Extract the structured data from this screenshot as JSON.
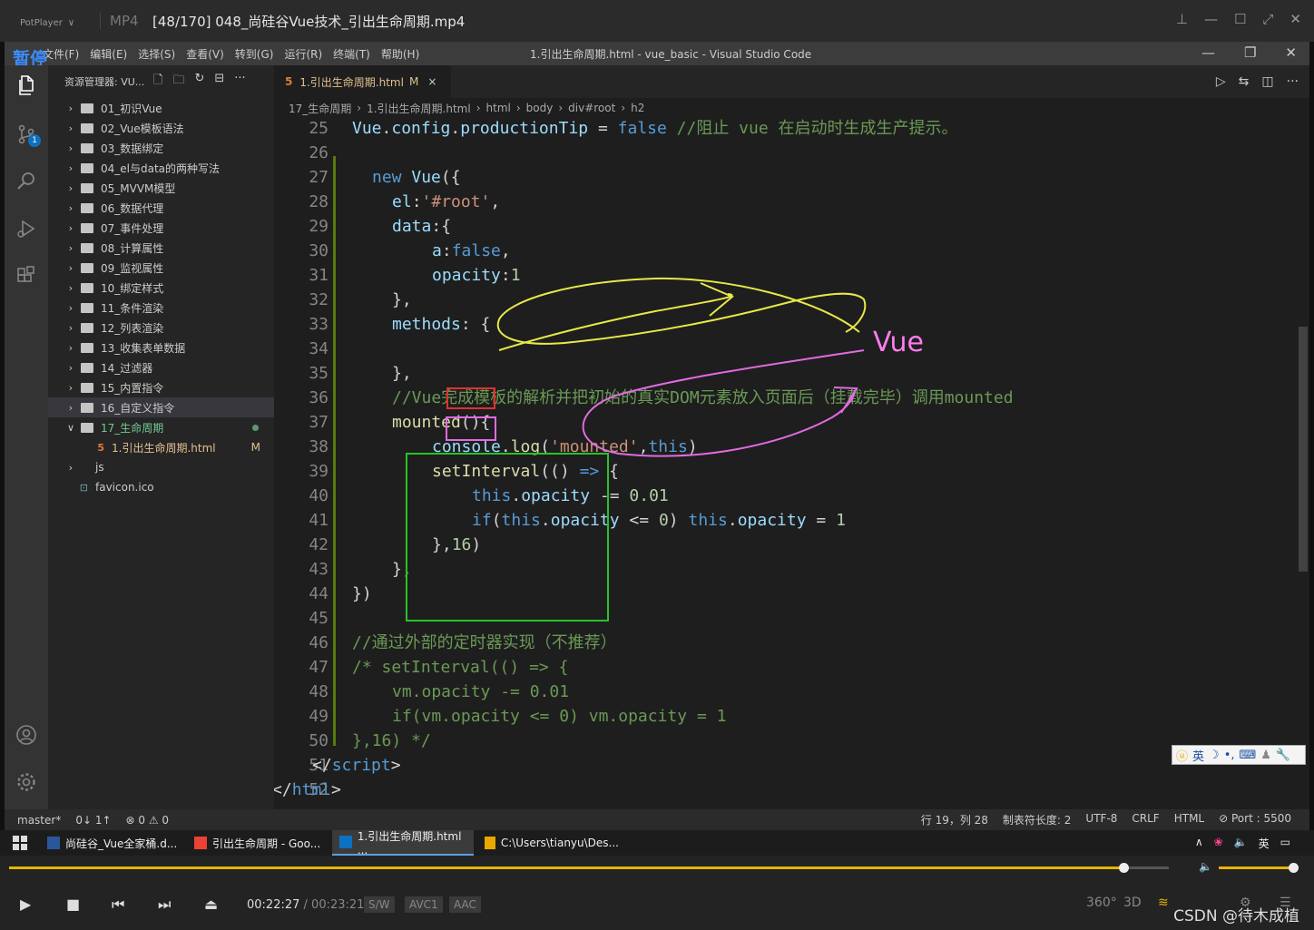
{
  "player": {
    "app_name": "PotPlayer",
    "format": "MP4",
    "file_title": "[48/170] 048_尚硅谷Vue技术_引出生命周期.mp4",
    "paused_label": "暂停",
    "time_current": "00:22:27",
    "time_total": "00:23:21",
    "chips": [
      "S/W",
      "AVC1",
      "AAC"
    ],
    "right_labels": [
      "360°",
      "3D"
    ],
    "watermark": "CSDN @待木成植",
    "progress_fraction": 0.961,
    "volume_fraction": 1.0,
    "accent_color": "#e8b400"
  },
  "vscode": {
    "menu": [
      "文件(F)",
      "编辑(E)",
      "选择(S)",
      "查看(V)",
      "转到(G)",
      "运行(R)",
      "终端(T)",
      "帮助(H)"
    ],
    "window_title": "1.引出生命周期.html - vue_basic - Visual Studio Code",
    "explorer_title": "资源管理器: VU...",
    "tree": [
      {
        "label": "01_初识Vue"
      },
      {
        "label": "02_Vue模板语法"
      },
      {
        "label": "03_数据绑定"
      },
      {
        "label": "04_el与data的两种写法"
      },
      {
        "label": "05_MVVM模型"
      },
      {
        "label": "06_数据代理"
      },
      {
        "label": "07_事件处理"
      },
      {
        "label": "08_计算属性"
      },
      {
        "label": "09_监视属性"
      },
      {
        "label": "10_绑定样式"
      },
      {
        "label": "11_条件渲染"
      },
      {
        "label": "12_列表渲染"
      },
      {
        "label": "13_收集表单数据"
      },
      {
        "label": "14_过滤器"
      },
      {
        "label": "15_内置指令"
      },
      {
        "label": "16_自定义指令"
      },
      {
        "label": "17_生命周期"
      }
    ],
    "open_file": "1.引出生命周期.html",
    "open_file_flag": "M",
    "extra_tree": [
      "js",
      "favicon.ico"
    ],
    "tab": {
      "label": "1.引出生命周期.html",
      "flag": "M",
      "close": "×"
    },
    "breadcrumb": [
      "17_生命周期",
      "1.引出生命周期.html",
      "html",
      "body",
      "div#root",
      "h2"
    ],
    "status_left": [
      "master*",
      "0↓ 1↑",
      "⊗ 0 ⚠ 0"
    ],
    "status_right": [
      "行 19，列 28",
      "制表符长度: 2",
      "UTF-8",
      "CRLF",
      "HTML",
      "⊘ Port : 5500"
    ],
    "ime_text": "英",
    "annotation_text": "Vue",
    "code": [
      {
        "n": "25",
        "html": "<span class='var'>Vue</span><span class='pun'>.</span><span class='var'>config</span><span class='pun'>.</span><span class='var'>productionTip</span><span class='pun'> = </span><span class='kw'>false</span><span class='cmt'> //阻止 vue 在启动时生成生产提示。</span>",
        "indent": 2
      },
      {
        "n": "26",
        "html": "",
        "indent": 0
      },
      {
        "n": "27",
        "html": "<span class='kw'>new</span> <span class='var'>Vue</span><span class='pun'>({</span>",
        "indent": 2.5
      },
      {
        "n": "28",
        "html": "<span class='var'>el</span><span class='pun'>:</span><span class='str'>'#root'</span><span class='pun'>,</span>",
        "indent": 3
      },
      {
        "n": "29",
        "html": "<span class='var'>data</span><span class='pun'>:{</span>",
        "indent": 3
      },
      {
        "n": "30",
        "html": "<span class='var'>a</span><span class='pun'>:</span><span class='kw'>false</span><span class='pun'>,</span>",
        "indent": 4
      },
      {
        "n": "31",
        "html": "<span class='var'>opacity</span><span class='pun'>:</span><span class='num'>1</span>",
        "indent": 4
      },
      {
        "n": "32",
        "html": "<span class='pun'>},</span>",
        "indent": 3
      },
      {
        "n": "33",
        "html": "<span class='var'>methods</span><span class='pun'>: {</span>",
        "indent": 3
      },
      {
        "n": "34",
        "html": "",
        "indent": 0
      },
      {
        "n": "35",
        "html": "<span class='pun'>},</span>",
        "indent": 3
      },
      {
        "n": "36",
        "html": "<span class='cmt'>//Vue完成模板的解析并把初始的真实DOM元素放入页面后（挂载完毕）调用mounted</span>",
        "indent": 3
      },
      {
        "n": "37",
        "html": "<span class='fn'>mounted</span><span class='pun'>(){</span>",
        "indent": 3
      },
      {
        "n": "38",
        "html": "<span class='var'>console</span><span class='pun'>.</span><span class='fn'>log</span><span class='pun'>(</span><span class='str'>'mounted'</span><span class='pun'>,</span><span class='kw'>this</span><span class='pun'>)</span>",
        "indent": 4
      },
      {
        "n": "39",
        "html": "<span class='fn'>setInterval</span><span class='pun'>(() </span><span class='kw'>=&gt;</span><span class='pun'> {</span>",
        "indent": 4
      },
      {
        "n": "40",
        "html": "<span class='kw'>this</span><span class='pun'>.</span><span class='var'>opacity</span><span class='pun'> -= </span><span class='num'>0.01</span>",
        "indent": 5
      },
      {
        "n": "41",
        "html": "<span class='kw'>if</span><span class='pun'>(</span><span class='kw'>this</span><span class='pun'>.</span><span class='var'>opacity</span><span class='pun'> &lt;= </span><span class='num'>0</span><span class='pun'>) </span><span class='kw'>this</span><span class='pun'>.</span><span class='var'>opacity</span><span class='pun'> = </span><span class='num'>1</span>",
        "indent": 5
      },
      {
        "n": "42",
        "html": "<span class='pun'>},</span><span class='num'>16</span><span class='pun'>)</span>",
        "indent": 4
      },
      {
        "n": "43",
        "html": "<span class='pun'>},</span>",
        "indent": 3
      },
      {
        "n": "44",
        "html": "<span class='pun'>})</span>",
        "indent": 2
      },
      {
        "n": "45",
        "html": "",
        "indent": 0
      },
      {
        "n": "46",
        "html": "<span class='cmt'>//通过外部的定时器实现（不推荐）</span>",
        "indent": 2
      },
      {
        "n": "47",
        "html": "<span class='cmt'>/* setInterval(() =&gt; {</span>",
        "indent": 2
      },
      {
        "n": "48",
        "html": "<span class='cmt'>vm.opacity -= 0.01</span>",
        "indent": 3
      },
      {
        "n": "49",
        "html": "<span class='cmt'>if(vm.opacity &lt;= 0) vm.opacity = 1</span>",
        "indent": 3
      },
      {
        "n": "50",
        "html": "<span class='cmt'>},16) */</span>",
        "indent": 2
      },
      {
        "n": "51",
        "html": "<span class='pun'>&lt;/</span><span class='tag'>script</span><span class='pun'>&gt;</span>",
        "indent": 1
      },
      {
        "n": "52",
        "html": "<span class='pun'>&lt;/</span><span class='tag'>html</span><span class='pun'>&gt;</span>",
        "indent": 0
      }
    ]
  },
  "taskbar": {
    "items": [
      "尚硅谷_Vue全家桶.d...",
      "引出生命周期 - Goo...",
      "1.引出生命周期.html ...",
      "C:\\Users\\tianyu\\Des..."
    ],
    "ime": "英"
  }
}
